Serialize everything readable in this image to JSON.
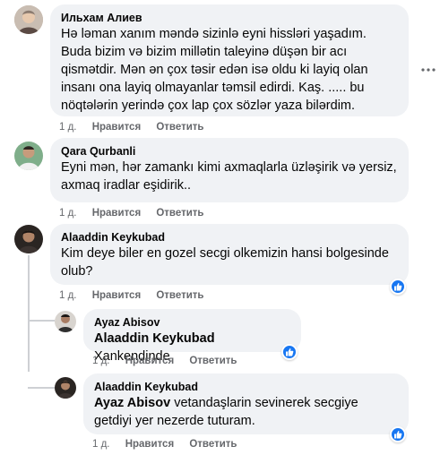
{
  "comments": [
    {
      "author": "Ильхам Алиев",
      "text": "Hə ləman xanım məndə sizinlə eyni hissləri yaşadım. Buda bizim və bizim millətin taleyinə düşən bir acı qismətdir. Mən ən çox təsir edən isə oldu ki layiq olan insanı ona layiq olmayanlar təmsil edirdi. Kaş. ..... bu nöqtələrin yerində çox lap çox sözlər yaza bilərdim.",
      "time": "1 д.",
      "like": "Нравится",
      "reply": "Ответить"
    },
    {
      "author": "Qara Qurbanli",
      "text": "Eyni mən, hər zamankı kimi axmaqlarla üzləşirik və yersiz, axmaq iradlar eşidirik..",
      "time": "1 д.",
      "like": "Нравится",
      "reply": "Ответить"
    },
    {
      "author": "Alaaddin Keykubad",
      "text": "Kim deye biler en gozel secgi olkemizin hansi bolgesinde olub?",
      "time": "1 д.",
      "like": "Нравится",
      "reply": "Ответить"
    }
  ],
  "replies": [
    {
      "author": "Ayaz Abisov",
      "mention": "Alaaddin Keykubad",
      "text": "Xankendinde",
      "time": "1 д.",
      "like": "Нравится",
      "reply": "Ответить"
    },
    {
      "author": "Alaaddin Keykubad",
      "mention": "Ayaz Abisov",
      "text": "vetandaşlarin sevinerek secgiye getdiyi yer nezerde tuturam.",
      "time": "1 д.",
      "like": "Нравится",
      "reply": "Ответить"
    }
  ],
  "colors": {
    "bubble": "#f0f2f5",
    "like": "#1877f2",
    "meta": "#65676b"
  },
  "icons": {
    "like_badge": "thumbs-up-icon",
    "more": "more-horizontal-icon"
  }
}
